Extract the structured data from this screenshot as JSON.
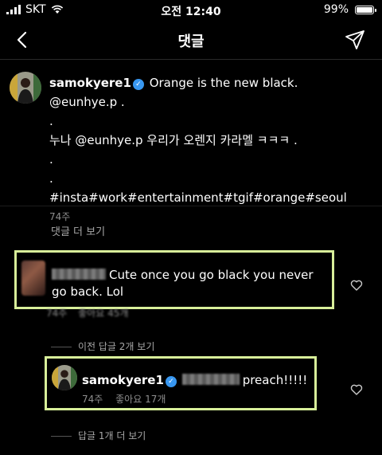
{
  "status_bar": {
    "carrier": "SKT",
    "time": "오전 12:40",
    "battery": "99%",
    "battery_level": 0.99
  },
  "nav": {
    "title": "댓글"
  },
  "caption": {
    "username": "samokyere1",
    "line1": "Orange is the new black. @eunhye.p .",
    "line2": ".",
    "line3": "누나 @eunhye.p  우리가 오렌지 카라멜 ㅋㅋㅋ .",
    "line4": ".",
    "line5": ".",
    "hashtags": "#insta#work#entertainment#tgif#orange#seoul",
    "age": "74주"
  },
  "view_more_comments": "댓글 더 보기",
  "comment1": {
    "text": "Cute once you go black you never go back. Lol",
    "age": "74주",
    "likes": "좋아요 45개"
  },
  "view_previous_replies": "이전 답글 2개 보기",
  "comment2": {
    "username": "samokyere1",
    "text": "preach!!!!!",
    "age": "74주",
    "likes": "좋아요 17개"
  },
  "view_more_replies": "답글 1개 더 보기"
}
